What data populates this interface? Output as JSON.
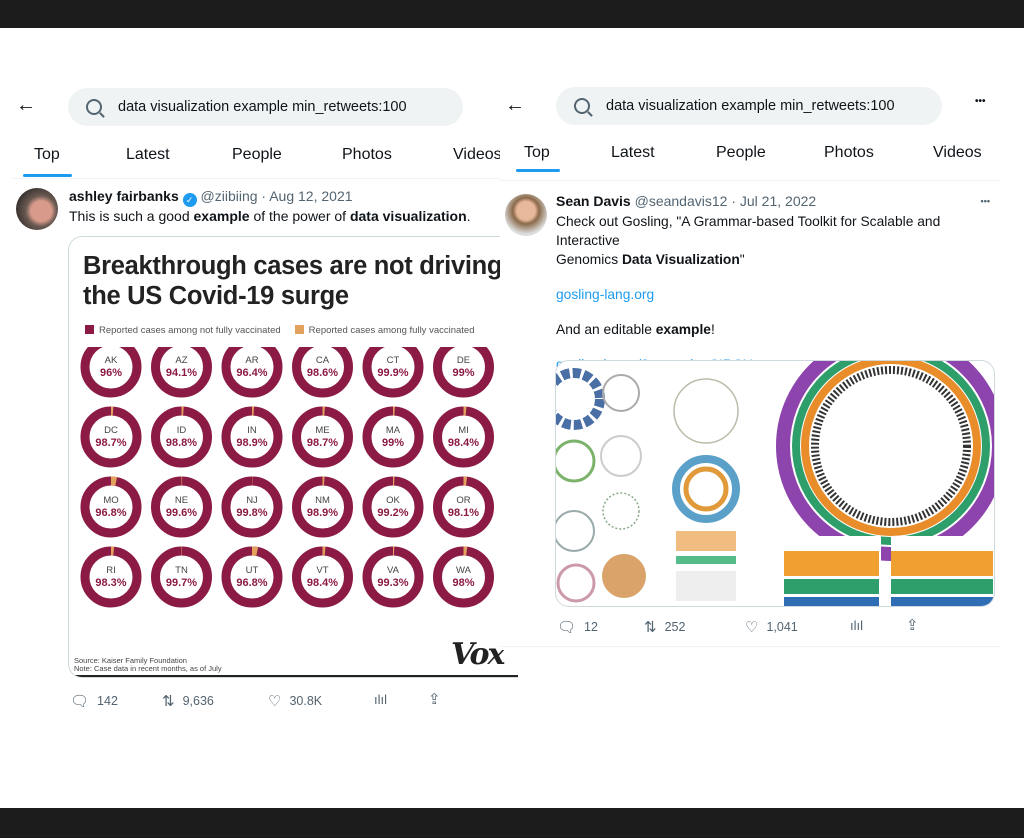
{
  "left": {
    "search_query": "data visualization example min_retweets:100",
    "tabs": [
      "Top",
      "Latest",
      "People",
      "Photos",
      "Videos"
    ],
    "tweet": {
      "author": "ashley fairbanks",
      "handle": "@ziibiing",
      "date": "Aug 12, 2021",
      "text_parts": [
        "This is such a good ",
        "example",
        " of the power of ",
        "data visualization",
        "."
      ],
      "replies": "142",
      "retweets": "9,636",
      "likes": "30.8K"
    },
    "infographic": {
      "title": "Breakthrough cases are not driving the US Covid-19 surge",
      "legend": [
        "Reported cases among not fully vaccinated",
        "Reported cases among fully vaccinated"
      ],
      "source": "Source: Kaiser Family Foundation",
      "note": "Note: Case data in recent months, as of July",
      "logo": "Vox",
      "colors": {
        "not_vaccinated": "#8b1a44",
        "vaccinated": "#e3a15e"
      }
    }
  },
  "chart_data": {
    "type": "pie",
    "title": "Breakthrough cases are not driving the US Covid-19 surge",
    "series_names": [
      "Reported cases among not fully vaccinated",
      "Reported cases among fully vaccinated"
    ],
    "states": [
      "AK",
      "AZ",
      "AR",
      "CA",
      "CT",
      "DE",
      "DC",
      "ID",
      "IN",
      "ME",
      "MA",
      "MI",
      "MO",
      "NE",
      "NJ",
      "NM",
      "OK",
      "OR",
      "RI",
      "TN",
      "UT",
      "VT",
      "VA",
      "WA"
    ],
    "labels": [
      "96%",
      "94.1%",
      "96.4%",
      "98.6%",
      "99.9%",
      "99%",
      "98.7%",
      "98.8%",
      "98.9%",
      "98.7%",
      "99%",
      "98.4%",
      "96.8%",
      "99.6%",
      "99.8%",
      "98.9%",
      "99.2%",
      "98.1%",
      "98.3%",
      "99.7%",
      "96.8%",
      "98.4%",
      "99.3%",
      "98%"
    ],
    "values": [
      96,
      94.1,
      96.4,
      98.6,
      99.9,
      99,
      98.7,
      98.8,
      98.9,
      98.7,
      99,
      98.4,
      96.8,
      99.6,
      99.8,
      98.9,
      99.2,
      98.1,
      98.3,
      99.7,
      96.8,
      98.4,
      99.3,
      98
    ]
  },
  "right": {
    "search_query": "data visualization example min_retweets:100",
    "tabs": [
      "Top",
      "Latest",
      "People",
      "Photos",
      "Videos"
    ],
    "more": "•••",
    "tweet": {
      "author": "Sean Davis",
      "handle": "@seandavis12",
      "date": "Jul 21, 2022",
      "more": "•••",
      "line1": "Check out Gosling, \"A Grammar-based Toolkit for Scalable and Interactive",
      "line2_pre": "Genomics ",
      "line2_bold": "Data Visualization",
      "line2_post": "\"",
      "link1": "gosling-lang.org",
      "line3_pre": "And an editable ",
      "line3_bold": "example",
      "line3_post": "!",
      "link2": "gosling.js.org/?example=CIRCU...",
      "replies": "12",
      "retweets": "252",
      "likes": "1,041"
    }
  }
}
